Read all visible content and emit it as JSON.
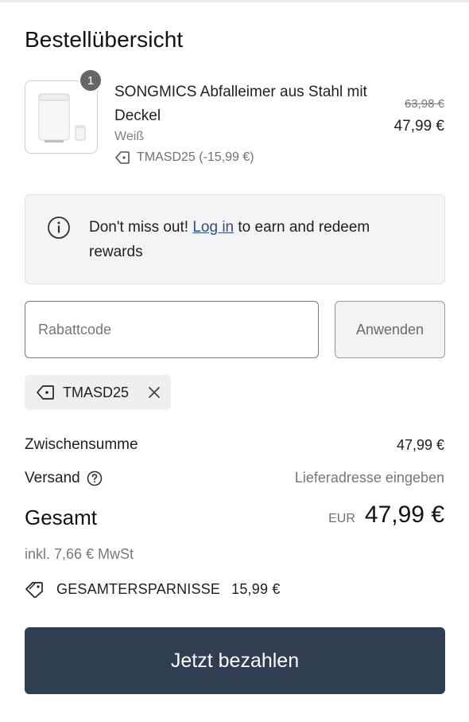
{
  "title": "Bestellübersicht",
  "product": {
    "quantity": "1",
    "name": "SONGMICS Abfalleimer aus Stahl mit Deckel",
    "variant": "Weiß",
    "discount_line": "TMASD25 (-15,99 €)",
    "price_original": "63,98 €",
    "price_current": "47,99 €",
    "image_icon": "trash-bin-image"
  },
  "info": {
    "text_before": "Don't miss out! ",
    "link": "Log in",
    "text_after": " to earn and redeem rewards",
    "icon": "info-icon"
  },
  "discount": {
    "placeholder": "Rabattcode",
    "value": "",
    "apply_label": "Anwenden",
    "applied_code": "TMASD25"
  },
  "totals": {
    "subtotal_label": "Zwischensumme",
    "subtotal_value": "47,99 €",
    "shipping_label": "Versand",
    "shipping_value": "Lieferadresse eingeben",
    "total_label": "Gesamt",
    "currency": "EUR",
    "total_value": "47,99 €",
    "tax_note": "inkl. 7,66 € MwSt",
    "savings_label": "GESAMTERSPARNISSE",
    "savings_value": "15,99 €"
  },
  "pay_button": "Jetzt bezahlen",
  "colors": {
    "pay_button_bg": "#2f3e52",
    "link": "#2f4f80",
    "info_box_bg": "#f4f4f4"
  }
}
